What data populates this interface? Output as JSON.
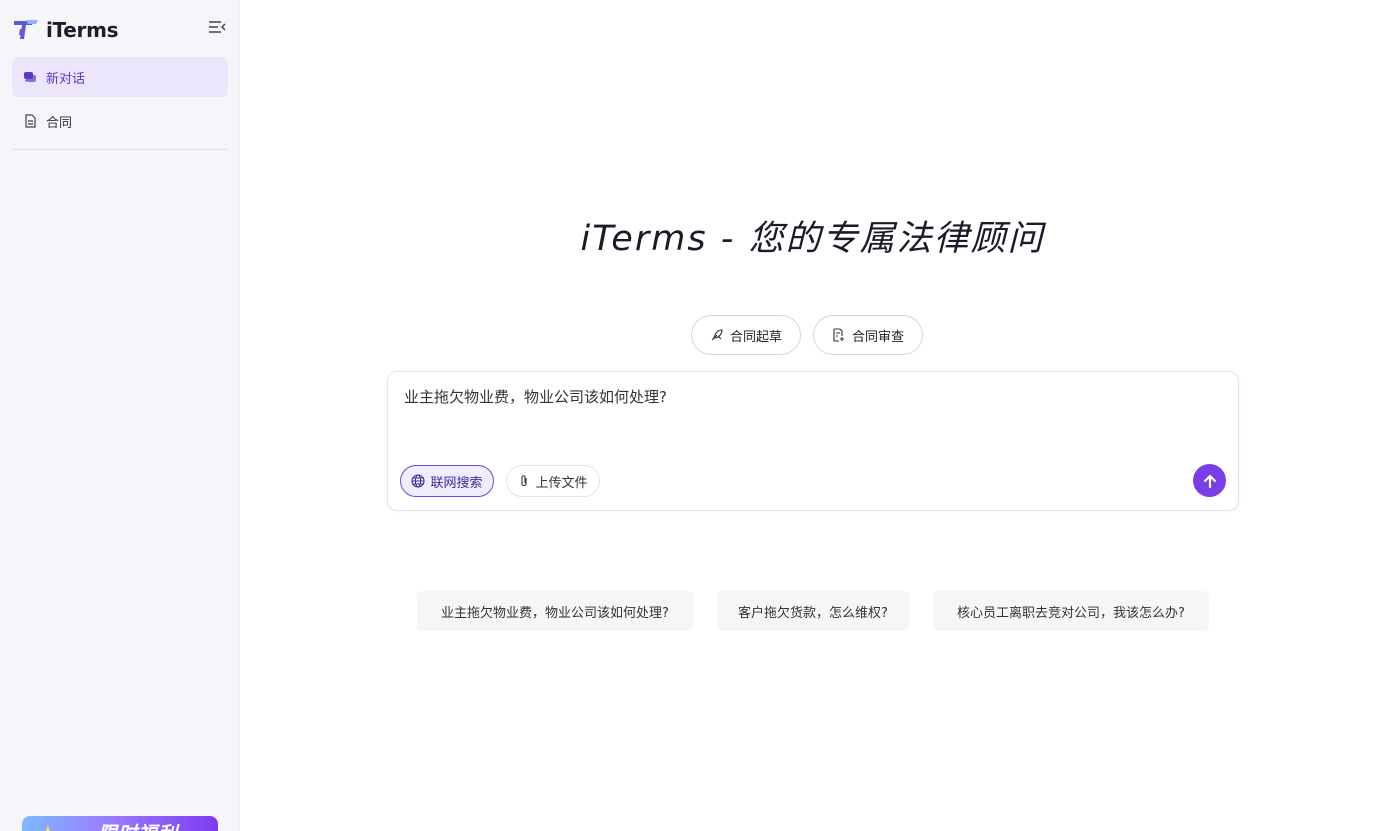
{
  "app": {
    "name": "iTerms"
  },
  "sidebar": {
    "items": [
      {
        "label": "新对话",
        "icon": "chat-bubbles-icon",
        "active": true
      },
      {
        "label": "合同",
        "icon": "document-icon",
        "active": false
      }
    ],
    "promo": {
      "text": "限时福利"
    }
  },
  "main": {
    "title": "iTerms - 您的专属法律顾问",
    "modes": [
      {
        "label": "合同起草",
        "icon": "quill-icon"
      },
      {
        "label": "合同审查",
        "icon": "document-review-icon"
      }
    ],
    "input": {
      "value": "业主拖欠物业费，物业公司该如何处理?"
    },
    "chips": {
      "web_search": "联网搜索",
      "upload": "上传文件"
    },
    "suggestions": [
      "业主拖欠物业费，物业公司该如何处理?",
      "客户拖欠货款，怎么维权?",
      "核心员工离职去竞对公司，我该怎么办?"
    ]
  },
  "colors": {
    "accent": "#7a3ee8",
    "active_bg": "#ebe6fb",
    "sidebar_bg": "#f6f6fa"
  }
}
